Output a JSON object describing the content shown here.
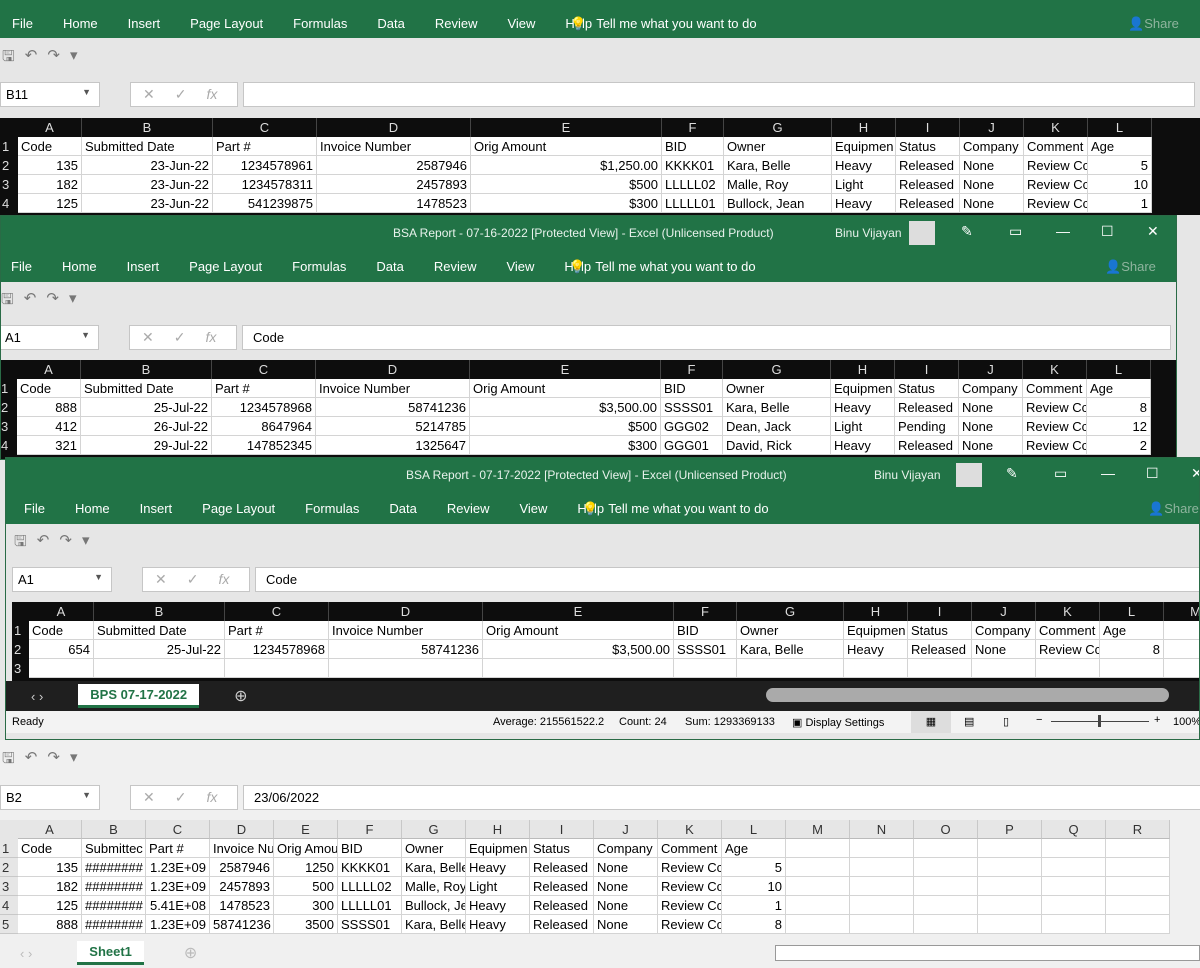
{
  "ribbon_tabs": [
    "File",
    "Home",
    "Insert",
    "Page Layout",
    "Formulas",
    "Data",
    "Review",
    "View",
    "Help"
  ],
  "tell_me": "Tell me what you want to do",
  "share": "Share",
  "user": "Binu Vijayan",
  "back_window": {
    "name_box": "B11",
    "formula": "",
    "columns": [
      "A",
      "B",
      "C",
      "D",
      "E",
      "F",
      "G",
      "H",
      "I",
      "J",
      "K",
      "L"
    ],
    "rows": [
      [
        "Code",
        "Submitted Date",
        "Part #",
        "Invoice Number",
        "Orig Amount",
        "BID",
        "Owner",
        "Equipmen",
        "Status",
        "Company",
        "Comment",
        "Age"
      ],
      [
        "135",
        "23-Jun-22",
        "1234578961",
        "2587946",
        "$1,250.00",
        "KKKK01",
        "Kara, Belle",
        "Heavy",
        "Released",
        "None",
        "Review Cc",
        "5"
      ],
      [
        "182",
        "23-Jun-22",
        "1234578311",
        "2457893",
        "$500",
        "LLLLL02",
        "Malle, Roy",
        "Light",
        "Released",
        "None",
        "Review Cc",
        "10"
      ],
      [
        "125",
        "23-Jun-22",
        "541239875",
        "1478523",
        "$300",
        "LLLLL01",
        "Bullock, Jean",
        "Heavy",
        "Released",
        "None",
        "Review Cc",
        "1"
      ]
    ]
  },
  "window_0716": {
    "title": "BSA Report - 07-16-2022  [Protected View]  -  Excel (Unlicensed Product)",
    "name_box": "A1",
    "formula": "Code",
    "columns": [
      "A",
      "B",
      "C",
      "D",
      "E",
      "F",
      "G",
      "H",
      "I",
      "J",
      "K",
      "L"
    ],
    "rows": [
      [
        "Code",
        "Submitted Date",
        "Part #",
        "Invoice Number",
        "Orig Amount",
        "BID",
        "Owner",
        "Equipmen",
        "Status",
        "Company",
        "Comment",
        "Age"
      ],
      [
        "888",
        "25-Jul-22",
        "1234578968",
        "58741236",
        "$3,500.00",
        "SSSS01",
        "Kara, Belle",
        "Heavy",
        "Released",
        "None",
        "Review Cc",
        "8"
      ],
      [
        "412",
        "26-Jul-22",
        "8647964",
        "5214785",
        "$500",
        "GGG02",
        "Dean, Jack",
        "Light",
        "Pending",
        "None",
        "Review Cc",
        "12"
      ],
      [
        "321",
        "29-Jul-22",
        "147852345",
        "1325647",
        "$300",
        "GGG01",
        "David, Rick",
        "Heavy",
        "Released",
        "None",
        "Review Cc",
        "2"
      ]
    ]
  },
  "window_0717": {
    "title": "BSA Report - 07-17-2022  [Protected View]  -  Excel (Unlicensed Product)",
    "name_box": "A1",
    "formula": "Code",
    "columns": [
      "A",
      "B",
      "C",
      "D",
      "E",
      "F",
      "G",
      "H",
      "I",
      "J",
      "K",
      "L",
      "M"
    ],
    "rows": [
      [
        "Code",
        "Submitted Date",
        "Part #",
        "Invoice Number",
        "Orig Amount",
        "BID",
        "Owner",
        "Equipmen",
        "Status",
        "Company",
        "Comment",
        "Age",
        ""
      ],
      [
        "654",
        "25-Jul-22",
        "1234578968",
        "58741236",
        "$3,500.00",
        "SSSS01",
        "Kara, Belle",
        "Heavy",
        "Released",
        "None",
        "Review Cc",
        "8",
        ""
      ],
      [
        "",
        "",
        "",
        "",
        "",
        "",
        "",
        "",
        "",
        "",
        "",
        "",
        ""
      ]
    ],
    "sheet_tab": "BPS 07-17-2022",
    "status": {
      "ready": "Ready",
      "average": "Average: 215561522.2",
      "count": "Count: 24",
      "sum": "Sum: 1293369133",
      "display": "Display Settings",
      "zoom": "100%"
    }
  },
  "bottom_window": {
    "name_box": "B2",
    "formula": "23/06/2022",
    "columns": [
      "A",
      "B",
      "C",
      "D",
      "E",
      "F",
      "G",
      "H",
      "I",
      "J",
      "K",
      "L",
      "M",
      "N",
      "O",
      "P",
      "Q",
      "R"
    ],
    "rows": [
      [
        "Code",
        "Submittec",
        "Part #",
        "Invoice Nu",
        "Orig Amou",
        "BID",
        "Owner",
        "Equipmen",
        "Status",
        "Company",
        "Comment",
        "Age",
        "",
        "",
        "",
        "",
        "",
        ""
      ],
      [
        "135",
        "########",
        "1.23E+09",
        "2587946",
        "1250",
        "KKKK01",
        "Kara, Belle",
        "Heavy",
        "Released",
        "None",
        "Review Cc",
        "5",
        "",
        "",
        "",
        "",
        "",
        ""
      ],
      [
        "182",
        "########",
        "1.23E+09",
        "2457893",
        "500",
        "LLLLL02",
        "Malle, Roy",
        "Light",
        "Released",
        "None",
        "Review Cc",
        "10",
        "",
        "",
        "",
        "",
        "",
        ""
      ],
      [
        "125",
        "########",
        "5.41E+08",
        "1478523",
        "300",
        "LLLLL01",
        "Bullock, Je",
        "Heavy",
        "Released",
        "None",
        "Review Cc",
        "1",
        "",
        "",
        "",
        "",
        "",
        ""
      ],
      [
        "888",
        "########",
        "1.23E+09",
        "58741236",
        "3500",
        "SSSS01",
        "Kara, Belle",
        "Heavy",
        "Released",
        "None",
        "Review Cc",
        "8",
        "",
        "",
        "",
        "",
        "",
        ""
      ]
    ],
    "sheet_tab": "Sheet1"
  }
}
